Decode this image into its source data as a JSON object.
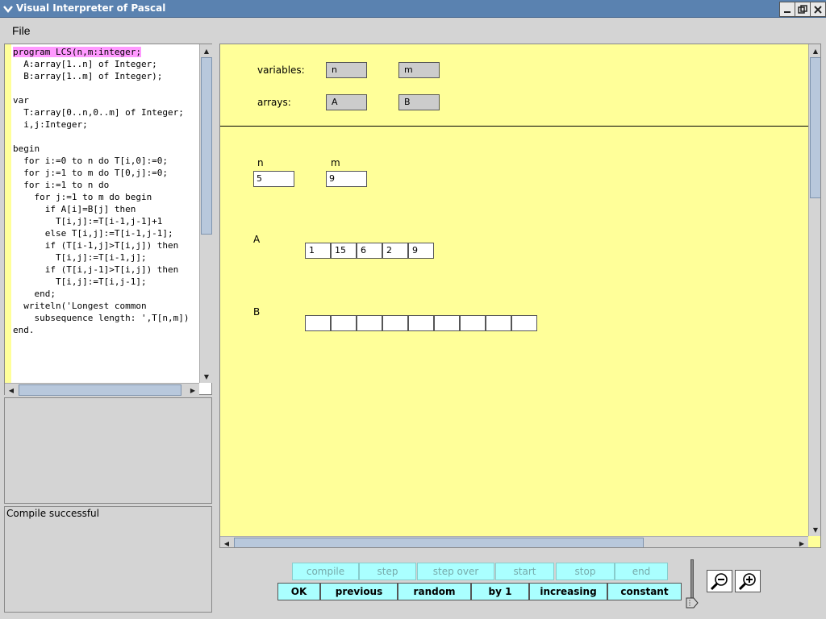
{
  "window": {
    "title": "Visual Interpreter of Pascal"
  },
  "menu": {
    "file_label": "File"
  },
  "code": {
    "lines": [
      "program LCS(n,m:integer;",
      "  A:array[1..n] of Integer;",
      "  B:array[1..m] of Integer);",
      "",
      "var",
      "  T:array[0..n,0..m] of Integer;",
      "  i,j:Integer;",
      "",
      "begin",
      "  for i:=0 to n do T[i,0]:=0;",
      "  for j:=1 to m do T[0,j]:=0;",
      "  for i:=1 to n do",
      "    for j:=1 to m do begin",
      "      if A[i]=B[j] then",
      "        T[i,j]:=T[i-1,j-1]+1",
      "      else T[i,j]:=T[i-1,j-1];",
      "      if (T[i-1,j]>T[i,j]) then",
      "        T[i,j]:=T[i-1,j];",
      "      if (T[i,j-1]>T[i,j]) then",
      "        T[i,j]:=T[i,j-1];",
      "    end;",
      "  writeln('Longest common",
      "    subsequence length: ',T[n,m])",
      "end."
    ],
    "highlight_line": 0
  },
  "status": {
    "message": "Compile successful"
  },
  "canvas": {
    "variables_label": "variables:",
    "arrays_label": "arrays:",
    "variable_names": [
      "n",
      "m"
    ],
    "array_names": [
      "A",
      "B"
    ],
    "values": [
      {
        "name": "n",
        "value": "5"
      },
      {
        "name": "m",
        "value": "9"
      }
    ],
    "array_A": {
      "name": "A",
      "cells": [
        "1",
        "15",
        "6",
        "2",
        "9"
      ]
    },
    "array_B": {
      "name": "B",
      "cells": [
        "",
        "",
        "",
        "",
        "",
        "",
        "",
        "",
        ""
      ]
    }
  },
  "controls": {
    "row1": [
      "compile",
      "step",
      "step over",
      "start",
      "stop",
      "end"
    ],
    "row2": [
      "OK",
      "previous",
      "random",
      "by 1",
      "increasing",
      "constant"
    ]
  },
  "colors": {
    "canvas_bg": "#ffff99",
    "highlight": "#ff99ff",
    "button_bg": "#aaffff"
  },
  "icons": {
    "zoom_out": "zoom-out-icon",
    "zoom_in": "zoom-in-icon"
  }
}
